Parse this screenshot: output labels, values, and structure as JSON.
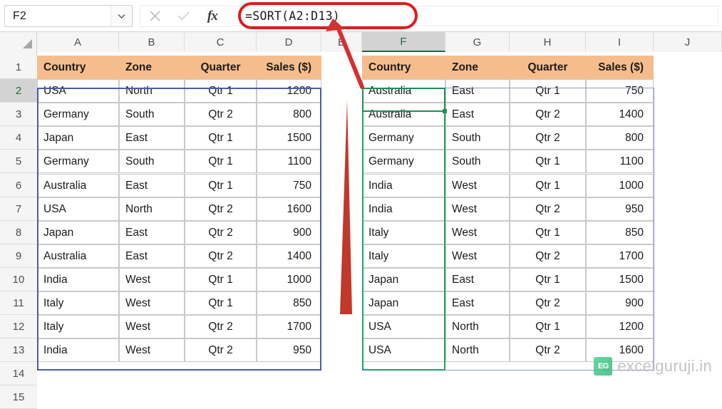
{
  "formula_bar": {
    "name_box_value": "F2",
    "name_box_chevron": "⌄",
    "cancel_icon": "cancel-icon",
    "confirm_icon": "confirm-icon",
    "function_icon": "fx",
    "formula_value": "=SORT(A2:D13)",
    "formula_placeholder": ""
  },
  "grid": {
    "columns": [
      "A",
      "B",
      "C",
      "D",
      "E",
      "F",
      "G",
      "H",
      "I",
      "J"
    ],
    "active_column": "F",
    "rows": [
      "1",
      "2",
      "3",
      "4",
      "5",
      "6",
      "7",
      "8",
      "9",
      "10",
      "11",
      "12",
      "13",
      "14",
      "15"
    ],
    "active_row": "2"
  },
  "source_table": {
    "range": "A1:D13",
    "headers": [
      "Country",
      "Zone",
      "Quarter",
      "Sales ($)"
    ],
    "rows": [
      [
        "USA",
        "North",
        "Qtr 1",
        "1200"
      ],
      [
        "Germany",
        "South",
        "Qtr 2",
        "800"
      ],
      [
        "Japan",
        "East",
        "Qtr 1",
        "1500"
      ],
      [
        "Germany",
        "South",
        "Qtr 1",
        "1100"
      ],
      [
        "Australia",
        "East",
        "Qtr 1",
        "750"
      ],
      [
        "USA",
        "North",
        "Qtr 2",
        "1600"
      ],
      [
        "Japan",
        "East",
        "Qtr 2",
        "900"
      ],
      [
        "Australia",
        "East",
        "Qtr 2",
        "1400"
      ],
      [
        "India",
        "West",
        "Qtr 1",
        "1000"
      ],
      [
        "Italy",
        "West",
        "Qtr 1",
        "850"
      ],
      [
        "Italy",
        "West",
        "Qtr 2",
        "1700"
      ],
      [
        "India",
        "West",
        "Qtr 2",
        "950"
      ]
    ]
  },
  "result_table": {
    "range": "F1:I13",
    "headers": [
      "Country",
      "Zone",
      "Quarter",
      "Sales ($)"
    ],
    "rows": [
      [
        "Australia",
        "East",
        "Qtr 1",
        "750"
      ],
      [
        "Australia",
        "East",
        "Qtr 2",
        "1400"
      ],
      [
        "Germany",
        "South",
        "Qtr 2",
        "800"
      ],
      [
        "Germany",
        "South",
        "Qtr 1",
        "1100"
      ],
      [
        "India",
        "West",
        "Qtr 1",
        "1000"
      ],
      [
        "India",
        "West",
        "Qtr 2",
        "950"
      ],
      [
        "Italy",
        "West",
        "Qtr 1",
        "850"
      ],
      [
        "Italy",
        "West",
        "Qtr 2",
        "1700"
      ],
      [
        "Japan",
        "East",
        "Qtr 1",
        "1500"
      ],
      [
        "Japan",
        "East",
        "Qtr 2",
        "900"
      ],
      [
        "USA",
        "North",
        "Qtr 1",
        "1200"
      ],
      [
        "USA",
        "North",
        "Qtr 2",
        "1600"
      ]
    ]
  },
  "annotations": {
    "formula_highlight_color": "#e01b1b",
    "arrow_color": "#d63030",
    "pointer_color": "#c0392b"
  },
  "watermark": {
    "logo_text": "EG",
    "site_text": "excelguruji.in"
  },
  "colors": {
    "header_fill": "#f6bd8c",
    "selection_border": "#4b5ba6",
    "spill_border": "#8c9ccf",
    "active_green": "#21a366"
  }
}
